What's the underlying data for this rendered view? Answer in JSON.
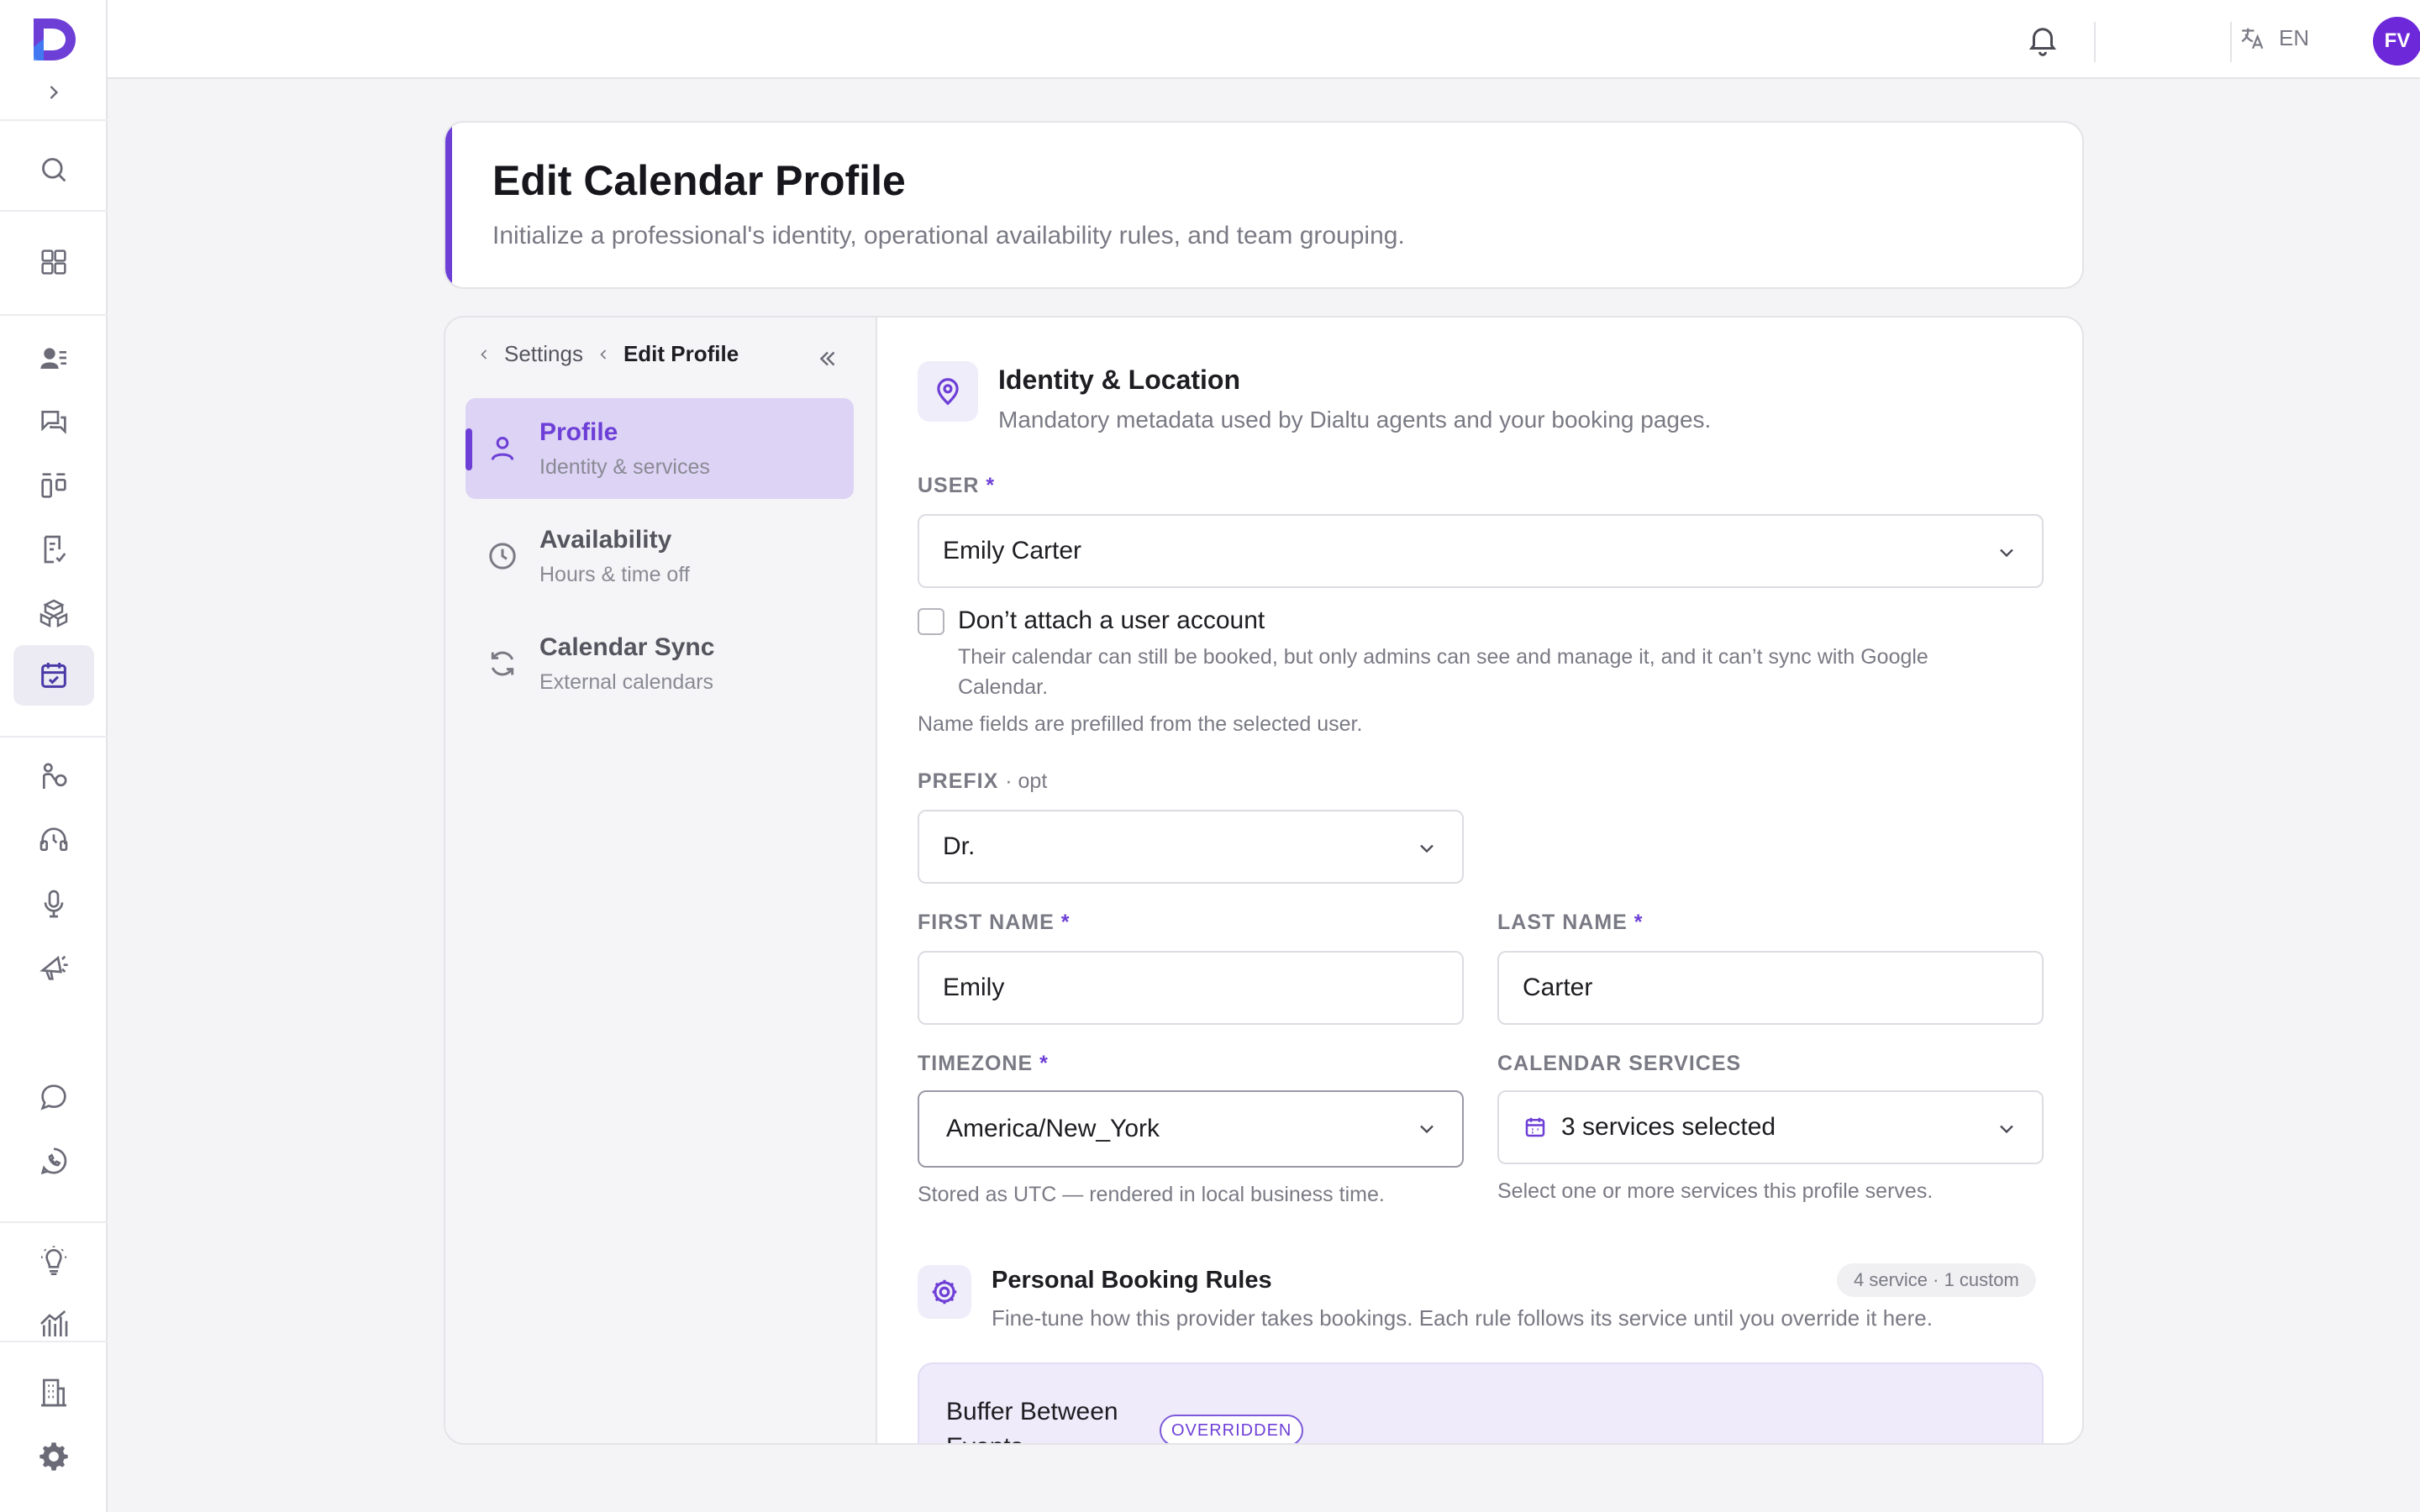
{
  "app": {
    "rail_icons": [
      "logo",
      "expand-chevron-icon",
      "search-icon",
      "grid-icon",
      "contacts-icon",
      "chat-bubbles-icon",
      "kanban-icon",
      "document-check-icon",
      "boxes-icon",
      "calendar-icon",
      "handshake-icon",
      "headset-icon",
      "microphone-icon",
      "megaphone-icon",
      "chat-icon",
      "whatsapp-icon",
      "lightbulb-icon",
      "analytics-icon",
      "building-icon",
      "gear-icon"
    ]
  },
  "topbar": {
    "language": "EN",
    "avatar_initials": "FV"
  },
  "header": {
    "title": "Edit Calendar Profile",
    "subtitle": "Initialize a professional's identity, operational availability rules, and team grouping."
  },
  "sidebar": {
    "breadcrumb": {
      "parent": "Settings",
      "current": "Edit Profile"
    },
    "items": [
      {
        "title": "Profile",
        "subtitle": "Identity & services",
        "active": true
      },
      {
        "title": "Availability",
        "subtitle": "Hours & time off",
        "active": false
      },
      {
        "title": "Calendar Sync",
        "subtitle": "External calendars",
        "active": false
      }
    ]
  },
  "identity": {
    "title": "Identity & Location",
    "description": "Mandatory metadata used by Dialtu agents and your booking pages.",
    "user_label": "USER",
    "required_mark": "*",
    "user_value": "Emily Carter",
    "no_account_label": "Don’t attach a user account",
    "no_account_help": "Their calendar can still be booked, but only admins can see and manage it, and it can’t sync with Google Calendar.",
    "prefill_note": "Name fields are prefilled from the selected user.",
    "prefix_label": "PREFIX",
    "prefix_opt": "· opt",
    "prefix_value": "Dr.",
    "first_name_label": "FIRST NAME",
    "first_name_value": "Emily",
    "last_name_label": "LAST NAME",
    "last_name_value": "Carter",
    "timezone_label": "TIMEZONE",
    "timezone_value": "America/New_York",
    "timezone_help": "Stored as UTC — rendered in local business time.",
    "services_label": "CALENDAR SERVICES",
    "services_value": "3 services selected",
    "services_help": "Select one or more services this profile serves."
  },
  "booking_rules": {
    "title": "Personal Booking Rules",
    "description": "Fine-tune how this provider takes bookings. Each rule follows its service until you override it here.",
    "badge": "4 service · 1 custom",
    "rule_title": "Buffer Between Events",
    "rule_badge": "OVERRIDDEN"
  },
  "colors": {
    "accent": "#6d3fd6",
    "avatar": "#6d28d9",
    "active_nav_bg": "#dcd3f5"
  }
}
